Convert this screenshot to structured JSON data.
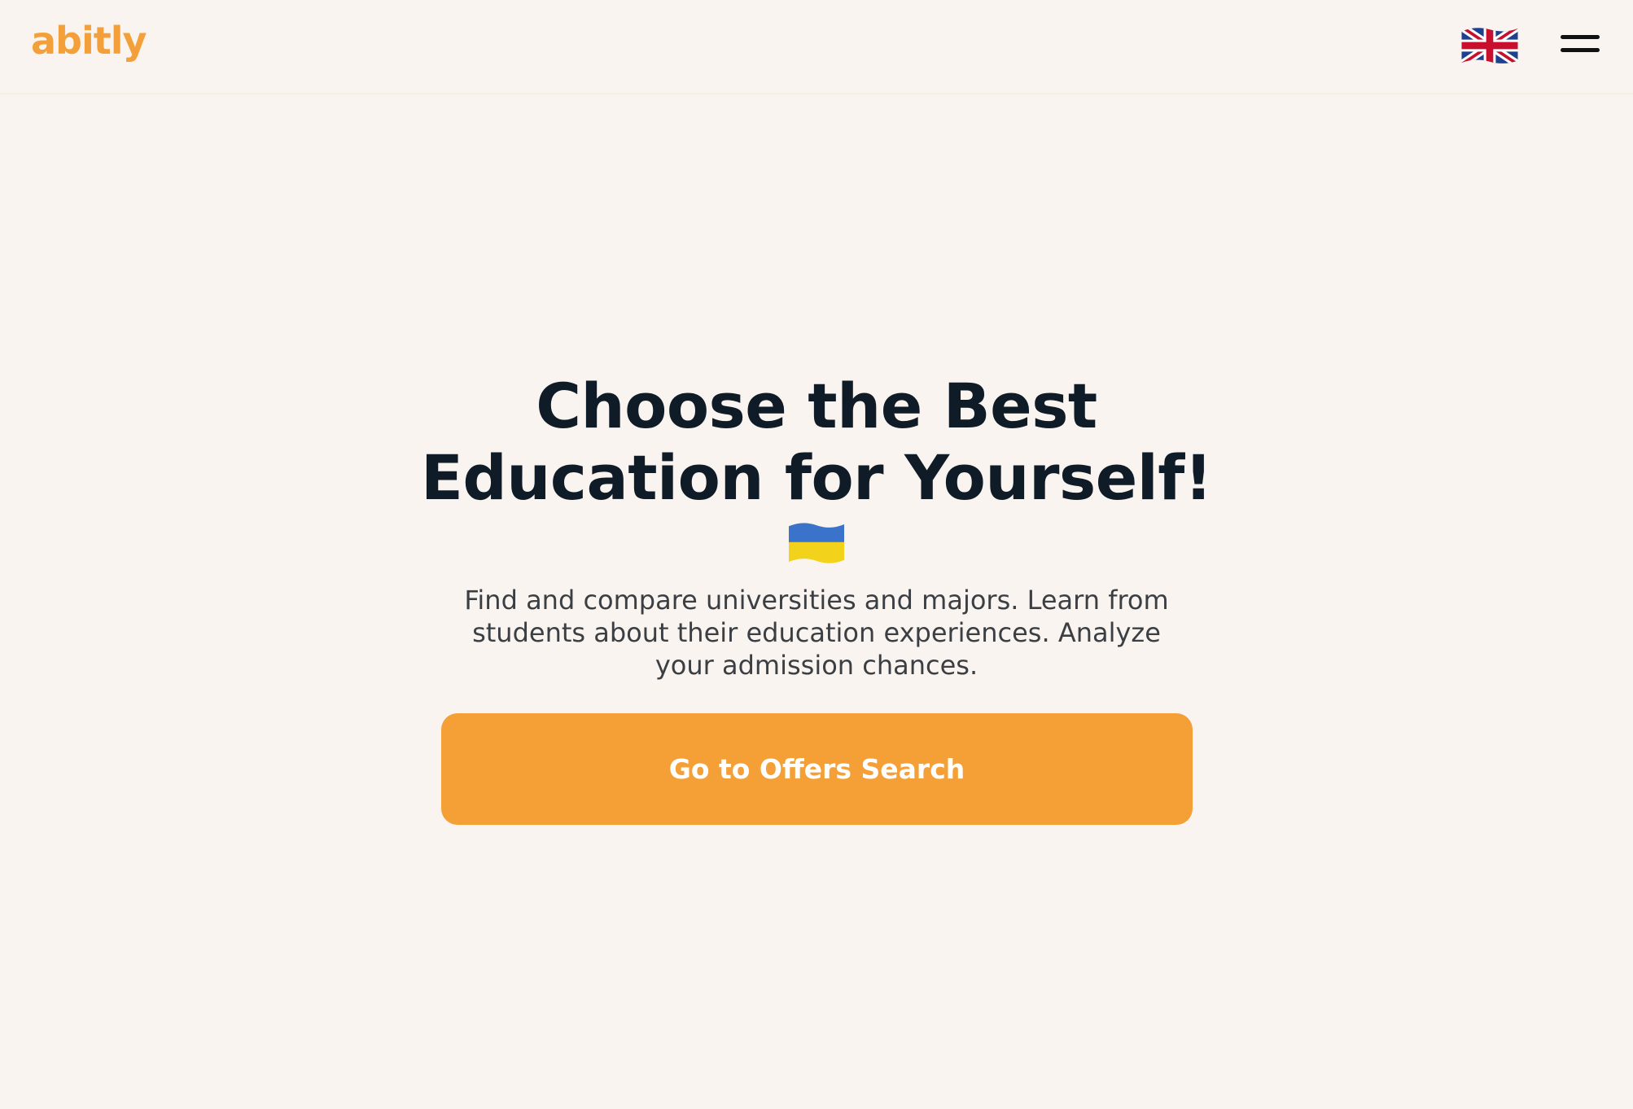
{
  "header": {
    "logo_text": "abitly",
    "language_flag_icon": "uk-flag-icon",
    "menu_icon": "hamburger-menu-icon"
  },
  "hero": {
    "title": "Choose the Best Education for Yourself!",
    "flag_icon": "ukraine-flag-icon",
    "subtitle": "Find and compare universities and majors. Learn from students about their education experiences. Analyze your admission chances.",
    "cta_label": "Go to Offers Search"
  },
  "colors": {
    "background": "#f9f4ef",
    "brand": "#f4a036",
    "heading": "#0f1b26",
    "body_text": "#3b3f44"
  }
}
